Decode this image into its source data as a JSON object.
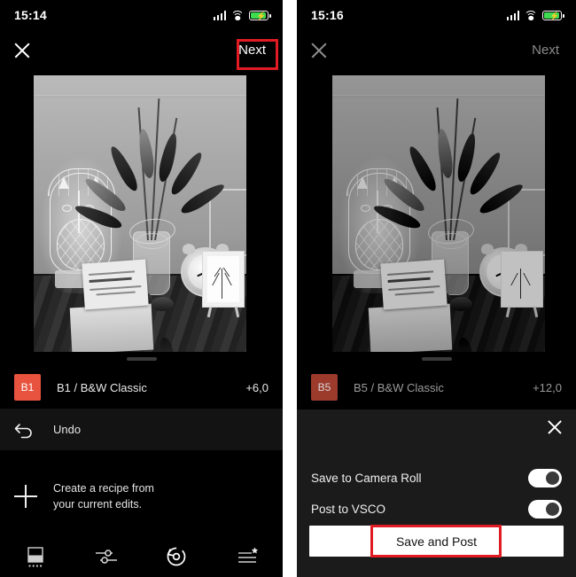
{
  "app": {
    "name": "VSCO",
    "screens": 2
  },
  "left": {
    "status": {
      "time": "15:14",
      "signal_icon": "cellular-bars-icon",
      "wifi_icon": "wifi-icon",
      "battery_icon": "battery-charging-icon"
    },
    "nav": {
      "close_icon": "close-x-icon",
      "next_label": "Next",
      "next_enabled": true
    },
    "photo": {
      "alt": "black and white photo of totoro lamp, flower vase and alarm clock on a desk",
      "filter_applied": "B1"
    },
    "preset": {
      "chip": "B1",
      "chip_color": "#e8533f",
      "name": "B1 / B&W Classic",
      "value": "+6,0"
    },
    "undo": {
      "icon": "undo-arrow-icon",
      "label": "Undo"
    },
    "recipe": {
      "icon": "plus-icon",
      "line1": "Create a recipe from",
      "line2": "your current edits."
    },
    "tabbar": [
      {
        "name": "presets",
        "icon": "presets-square-icon"
      },
      {
        "name": "adjust",
        "icon": "sliders-icon"
      },
      {
        "name": "history",
        "icon": "history-undo-icon",
        "active": true
      },
      {
        "name": "recipes",
        "icon": "recipes-star-icon"
      }
    ]
  },
  "right": {
    "status": {
      "time": "15:16",
      "signal_icon": "cellular-bars-icon",
      "wifi_icon": "wifi-icon",
      "battery_icon": "battery-charging-icon"
    },
    "nav": {
      "close_icon": "close-x-icon",
      "next_label": "Next",
      "next_enabled": false
    },
    "photo": {
      "alt": "same photo with B5 filter, dimmed behind sheet",
      "filter_applied": "B5"
    },
    "preset": {
      "chip": "B5",
      "chip_color": "#9c3a2c",
      "name": "B5 / B&W Classic",
      "value": "+12,0"
    },
    "sheet": {
      "close_icon": "close-x-icon",
      "options": [
        {
          "label": "Save to Camera Roll",
          "toggle": "on"
        },
        {
          "label": "Post to VSCO",
          "toggle": "on"
        }
      ],
      "primary_button": "Save and Post"
    }
  },
  "annotations": [
    {
      "target": "next-button",
      "color": "#e01b24"
    },
    {
      "target": "save-and-post-button",
      "color": "#e01b24"
    }
  ]
}
